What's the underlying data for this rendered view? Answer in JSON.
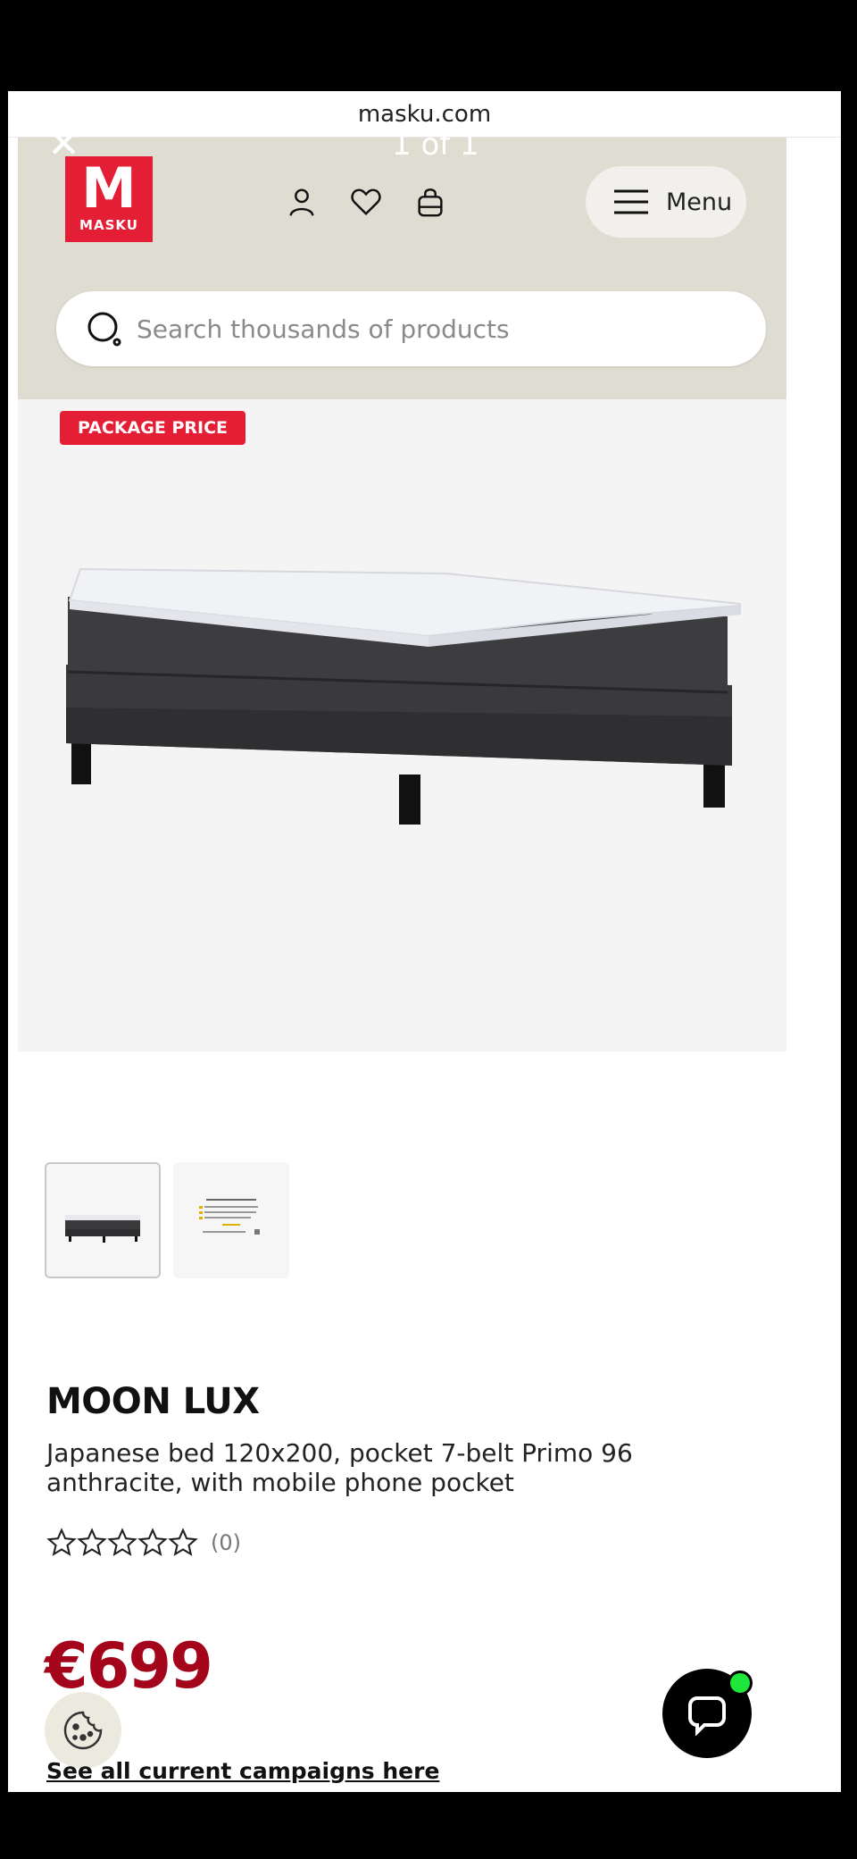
{
  "browser": {
    "url": "masku.com"
  },
  "overlay": {
    "close_glyph": "✕",
    "counter": "1 of 1"
  },
  "header": {
    "logo_letter": "M",
    "logo_text": "MASKU",
    "menu_label": "Menu",
    "icons": [
      "account-icon",
      "wishlist-icon",
      "cart-icon",
      "hamburger-icon"
    ]
  },
  "search": {
    "placeholder": "Search thousands of products"
  },
  "product": {
    "badge": "PACKAGE PRICE",
    "brand": "MOON LUX",
    "description": "Japanese bed 120x200, pocket 7-belt Primo 96 anthracite, with mobile phone pocket",
    "rating": {
      "stars": 0,
      "max_stars": 5,
      "count_label": "(0)"
    },
    "price": "€699",
    "campaigns_link": "See all current campaigns here",
    "thumbnail_count": 2
  },
  "colors": {
    "brand_red": "#e31e35",
    "price_red": "#a5051b",
    "header_bg": "#dfdcd1",
    "chat_status": "#1ee63a"
  }
}
